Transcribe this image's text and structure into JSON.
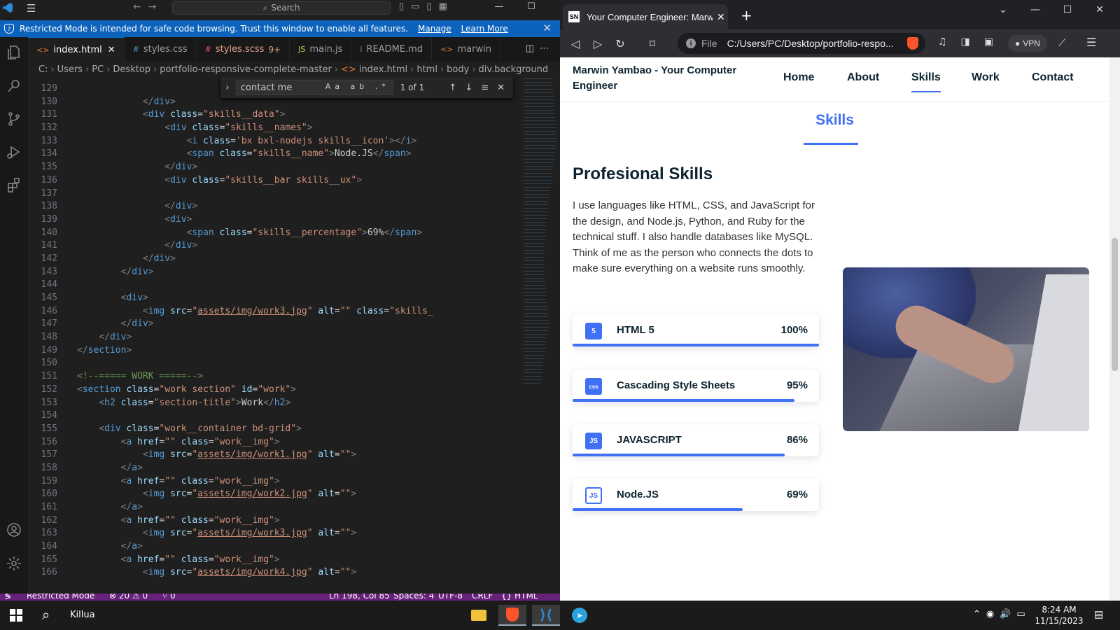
{
  "vscode": {
    "search_label": "Search",
    "banner": {
      "text": "Restricted Mode is intended for safe code browsing. Trust this window to enable all features.",
      "manage": "Manage",
      "learn_more": "Learn More"
    },
    "tabs": [
      {
        "icon": "<>",
        "label": "index.html",
        "active": true
      },
      {
        "icon": "#",
        "label": "styles.css"
      },
      {
        "icon": "#",
        "label": "styles.scss",
        "badge": "9+"
      },
      {
        "icon": "JS",
        "label": "main.js"
      },
      {
        "icon": "i",
        "label": "README.md"
      },
      {
        "icon": "<>",
        "label": "marwin"
      }
    ],
    "breadcrumb": [
      "C:",
      "Users",
      "PC",
      "Desktop",
      "portfolio-responsive-complete-master",
      "index.html",
      "html",
      "body",
      "div.background"
    ],
    "find": {
      "query": "contact me",
      "count": "1 of 1",
      "options": "Aa ab .*"
    },
    "lines": [
      "129",
      "130",
      "131",
      "132",
      "133",
      "134",
      "135",
      "136",
      "137",
      "138",
      "139",
      "140",
      "141",
      "142",
      "143",
      "144",
      "145",
      "146",
      "147",
      "148",
      "149",
      "150",
      "151",
      "152",
      "153",
      "154",
      "155",
      "156",
      "157",
      "158",
      "159",
      "160",
      "161",
      "162",
      "163",
      "164",
      "165",
      "166"
    ],
    "status": {
      "mode": "Restricted Mode",
      "problems": "⊗ 20 ⚠ 0",
      "ports": "⑂ 0",
      "position": "Ln 198, Col 85",
      "spaces": "Spaces: 4",
      "encoding": "UTF-8",
      "eol": "CRLF",
      "language": "{} HTML"
    }
  },
  "browser": {
    "tab_title": "Your Computer Engineer: Marwin",
    "url_scheme": "File",
    "url_path": "C:/Users/PC/Desktop/portfolio-respo...",
    "vpn": "VPN",
    "site": {
      "logo": "Marwin Yambao - Your Computer Engineer",
      "menu": [
        "Home",
        "About",
        "Skills",
        "Work",
        "Contact"
      ],
      "active_menu": "Skills",
      "section_title": "Skills",
      "subtitle": "Profesional Skills",
      "paragraph": "I use languages like HTML, CSS, and JavaScript for the design, and Node.js, Python, and Ruby for the technical stuff. I also handle databases like MySQL. Think of me as the person who connects the dots to make sure everything on a website runs smoothly.",
      "skills": [
        {
          "name": "HTML 5",
          "percent": "100%",
          "level": 1.0,
          "icon": "5"
        },
        {
          "name": "Cascading Style Sheets",
          "percent": "95%",
          "level": 0.9,
          "icon": "css"
        },
        {
          "name": "JAVASCRIPT",
          "percent": "86%",
          "level": 0.86,
          "icon": "JS"
        },
        {
          "name": "Node.JS",
          "percent": "69%",
          "level": 0.69,
          "icon": "JS"
        }
      ]
    }
  },
  "taskbar": {
    "user": "Killua",
    "time": "8:24 AM",
    "date": "11/15/2023"
  },
  "colors": {
    "accent": "#4070f4",
    "vscode_banner": "#0d63bc",
    "status_bar": "#68217a"
  }
}
